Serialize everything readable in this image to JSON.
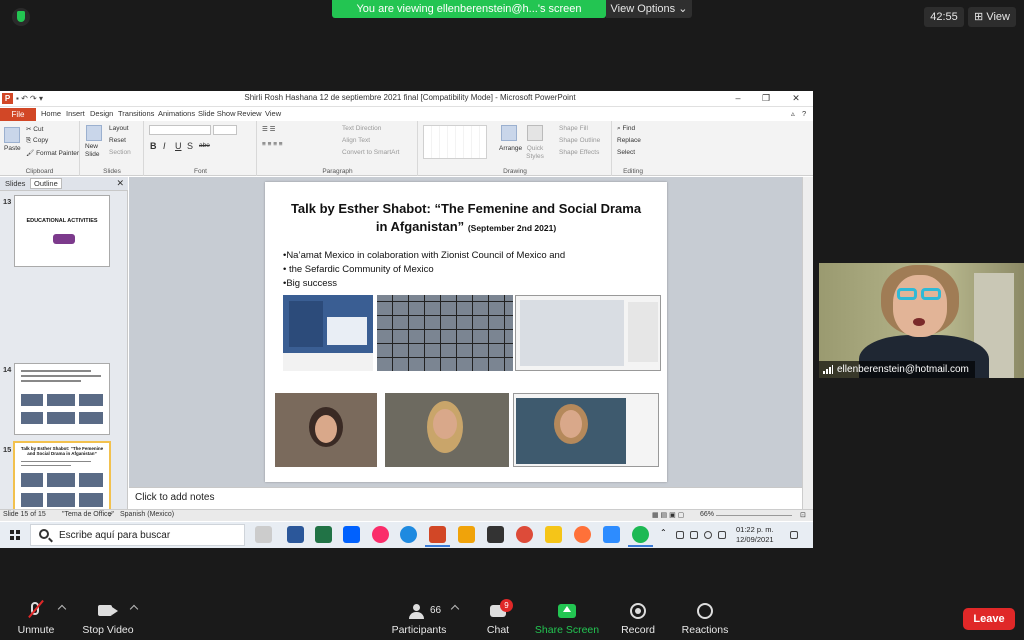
{
  "zoom": {
    "banner_text": "You are viewing ellenberenstein@h...'s screen",
    "view_options": "View Options",
    "timer": "42:55",
    "view_button": "View",
    "participant_name": "ellenberenstein@hotmail.com",
    "toolbar": {
      "unmute": "Unmute",
      "stop_video": "Stop Video",
      "participants": "Participants",
      "participants_count": "66",
      "chat": "Chat",
      "chat_badge": "9",
      "share_screen": "Share Screen",
      "record": "Record",
      "reactions": "Reactions",
      "leave": "Leave"
    }
  },
  "ppt": {
    "file_icon_letter": "P",
    "window_title": "Shirli Rosh Hashana 12 de septiembre 2021 final [Compatibility Mode] - Microsoft PowerPoint",
    "tabs": [
      "File",
      "Home",
      "Insert",
      "Design",
      "Transitions",
      "Animations",
      "Slide Show",
      "Review",
      "View"
    ],
    "ribbon": {
      "clipboard": {
        "label": "Clipboard",
        "paste": "Paste",
        "cut": "Cut",
        "copy": "Copy",
        "format_painter": "Format Painter"
      },
      "slides": {
        "label": "Slides",
        "new_slide": "New Slide",
        "layout": "Layout",
        "reset": "Reset",
        "section": "Section"
      },
      "font": {
        "label": "Font",
        "bold": "B",
        "italic": "I",
        "underline": "U",
        "shadow": "S",
        "strike": "abe"
      },
      "paragraph": {
        "label": "Paragraph",
        "text_direction": "Text Direction",
        "align_text": "Align Text",
        "convert_smartart": "Convert to SmartArt"
      },
      "drawing": {
        "label": "Drawing",
        "arrange": "Arrange",
        "quick_styles": "Quick Styles",
        "shape_fill": "Shape Fill",
        "shape_outline": "Shape Outline",
        "shape_effects": "Shape Effects"
      },
      "editing": {
        "label": "Editing",
        "find": "Find",
        "replace": "Replace",
        "select": "Select"
      }
    },
    "pane_tabs": {
      "slides": "Slides",
      "outline": "Outline"
    },
    "thumbnails": [
      {
        "num": "13",
        "text": "EDUCATIONAL ACTIVITIES"
      },
      {
        "num": "14",
        "text": ""
      },
      {
        "num": "15",
        "text": "Talk by Esther Shabot: “The Femenine and Social Drama in Afganistan”"
      }
    ],
    "slide": {
      "title": "Talk by Esther Shabot: “The Femenine and Social Drama in Afganistan”",
      "date": "(September 2nd 2021)",
      "bullets": [
        "•Na’amat Mexico in colaboration with Zionist Council of Mexico and",
        "• the Sefardic Community of Mexico",
        "•Big success"
      ]
    },
    "notes_placeholder": "Click to add notes",
    "status": {
      "slide_count": "Slide 15 of 15",
      "theme": "\"Tema de Office\"",
      "language": "Spanish (Mexico)",
      "zoom": "66%"
    }
  },
  "windows": {
    "search_placeholder": "Escribe aquí para buscar",
    "time": "01:22 p. m.",
    "date": "12/09/2021"
  }
}
